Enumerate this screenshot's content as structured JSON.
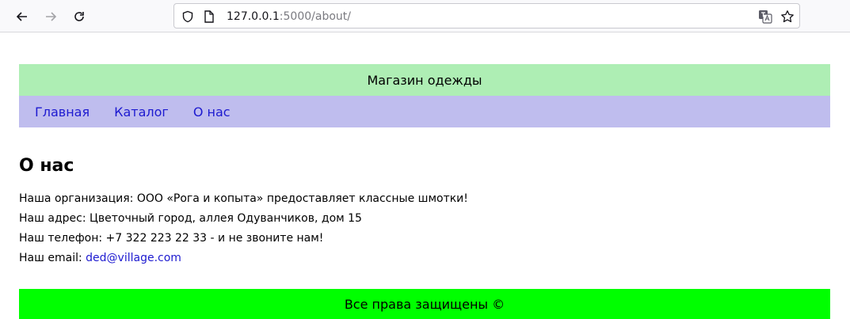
{
  "browser": {
    "url_host": "127.0.0.1",
    "url_path": ":5000/about/"
  },
  "header": {
    "title": "Магазин одежды"
  },
  "nav": {
    "items": [
      {
        "label": "Главная"
      },
      {
        "label": "Каталог"
      },
      {
        "label": "О нас"
      }
    ]
  },
  "main": {
    "title": "О нас",
    "org": "Наша организация: ООО «Рога и копыта» предоставляет классные шмотки!",
    "address": "Наш адрес: Цветочный город, аллея Одуванчиков, дом 15",
    "phone": "Наш телефон: +7 322 223 22 33 - и не звоните нам!",
    "email_label": "Наш email:",
    "email": "ded@village.com"
  },
  "footer": {
    "text": "Все права защищены ©"
  },
  "colors": {
    "header_bg": "#aeeeb4",
    "nav_bg": "#bfbdee",
    "link": "#1d1ad0",
    "footer_bg": "#00ff00"
  }
}
